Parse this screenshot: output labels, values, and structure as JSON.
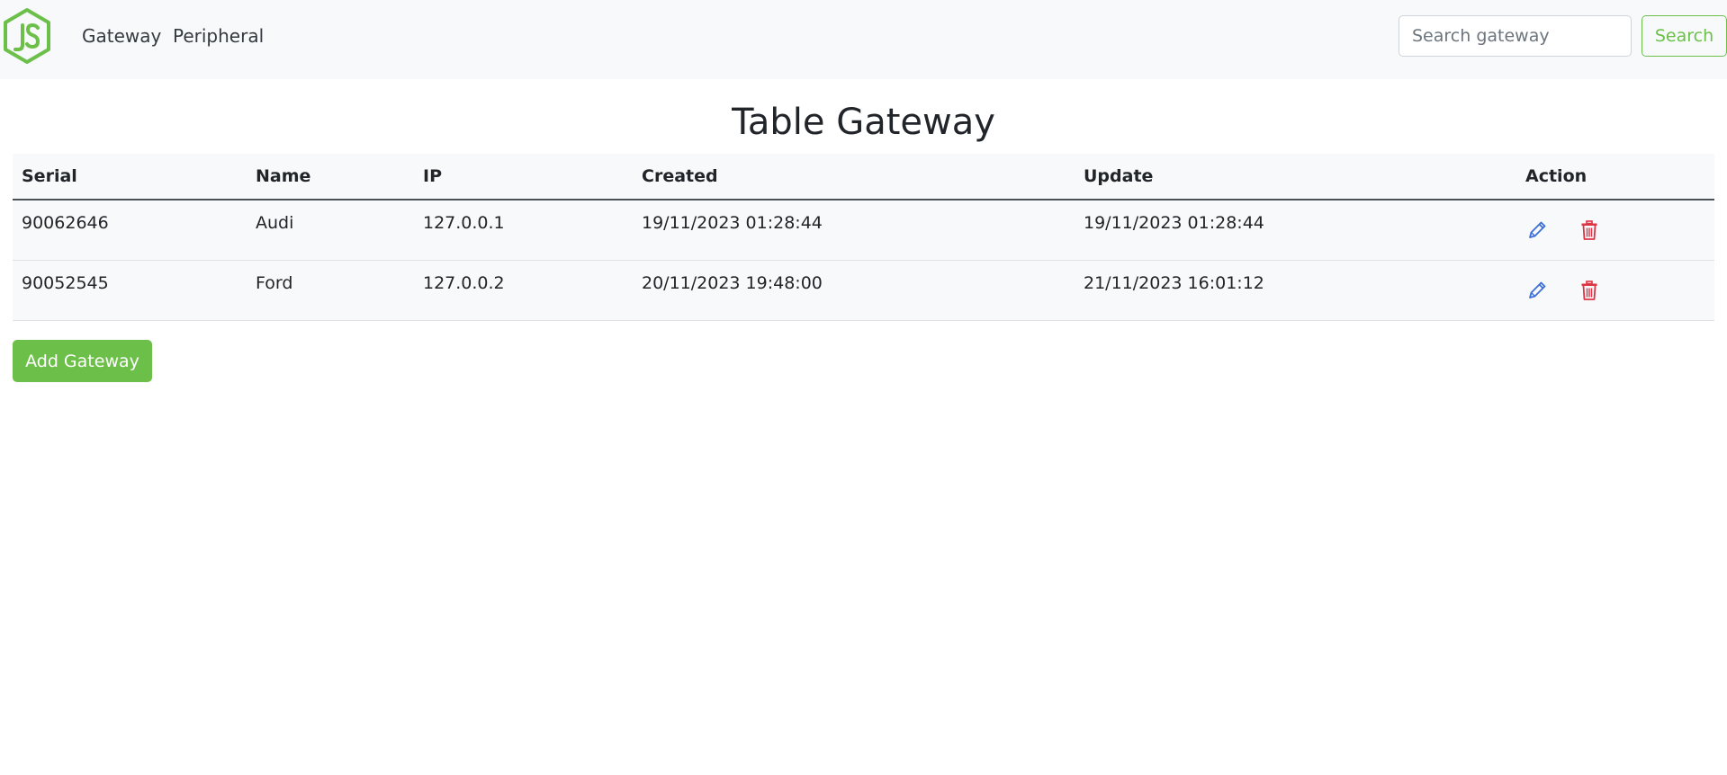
{
  "nav": {
    "logo_icon": "nodejs-logo-icon",
    "links": [
      "Gateway",
      "Peripheral"
    ]
  },
  "search": {
    "placeholder": "Search gateway",
    "value": "",
    "button_label": "Search"
  },
  "page": {
    "title": "Table Gateway"
  },
  "table": {
    "columns": [
      "Serial",
      "Name",
      "IP",
      "Created",
      "Update",
      "Action"
    ],
    "rows": [
      {
        "serial": "90062646",
        "name": "Audi",
        "ip": "127.0.0.1",
        "created": "19/11/2023 01:28:44",
        "update": "19/11/2023 01:28:44",
        "actions": [
          "edit-icon",
          "delete-icon"
        ]
      },
      {
        "serial": "90052545",
        "name": "Ford",
        "ip": "127.0.0.2",
        "created": "20/11/2023 19:48:00",
        "update": "21/11/2023 16:01:12",
        "actions": [
          "edit-icon",
          "delete-icon"
        ]
      }
    ]
  },
  "add_button_label": "Add Gateway",
  "colors": {
    "brand": "#6cc04a",
    "edit_icon": "#3b6fd9",
    "delete_icon": "#dc3545",
    "navbar_bg": "#f8f9fa"
  }
}
